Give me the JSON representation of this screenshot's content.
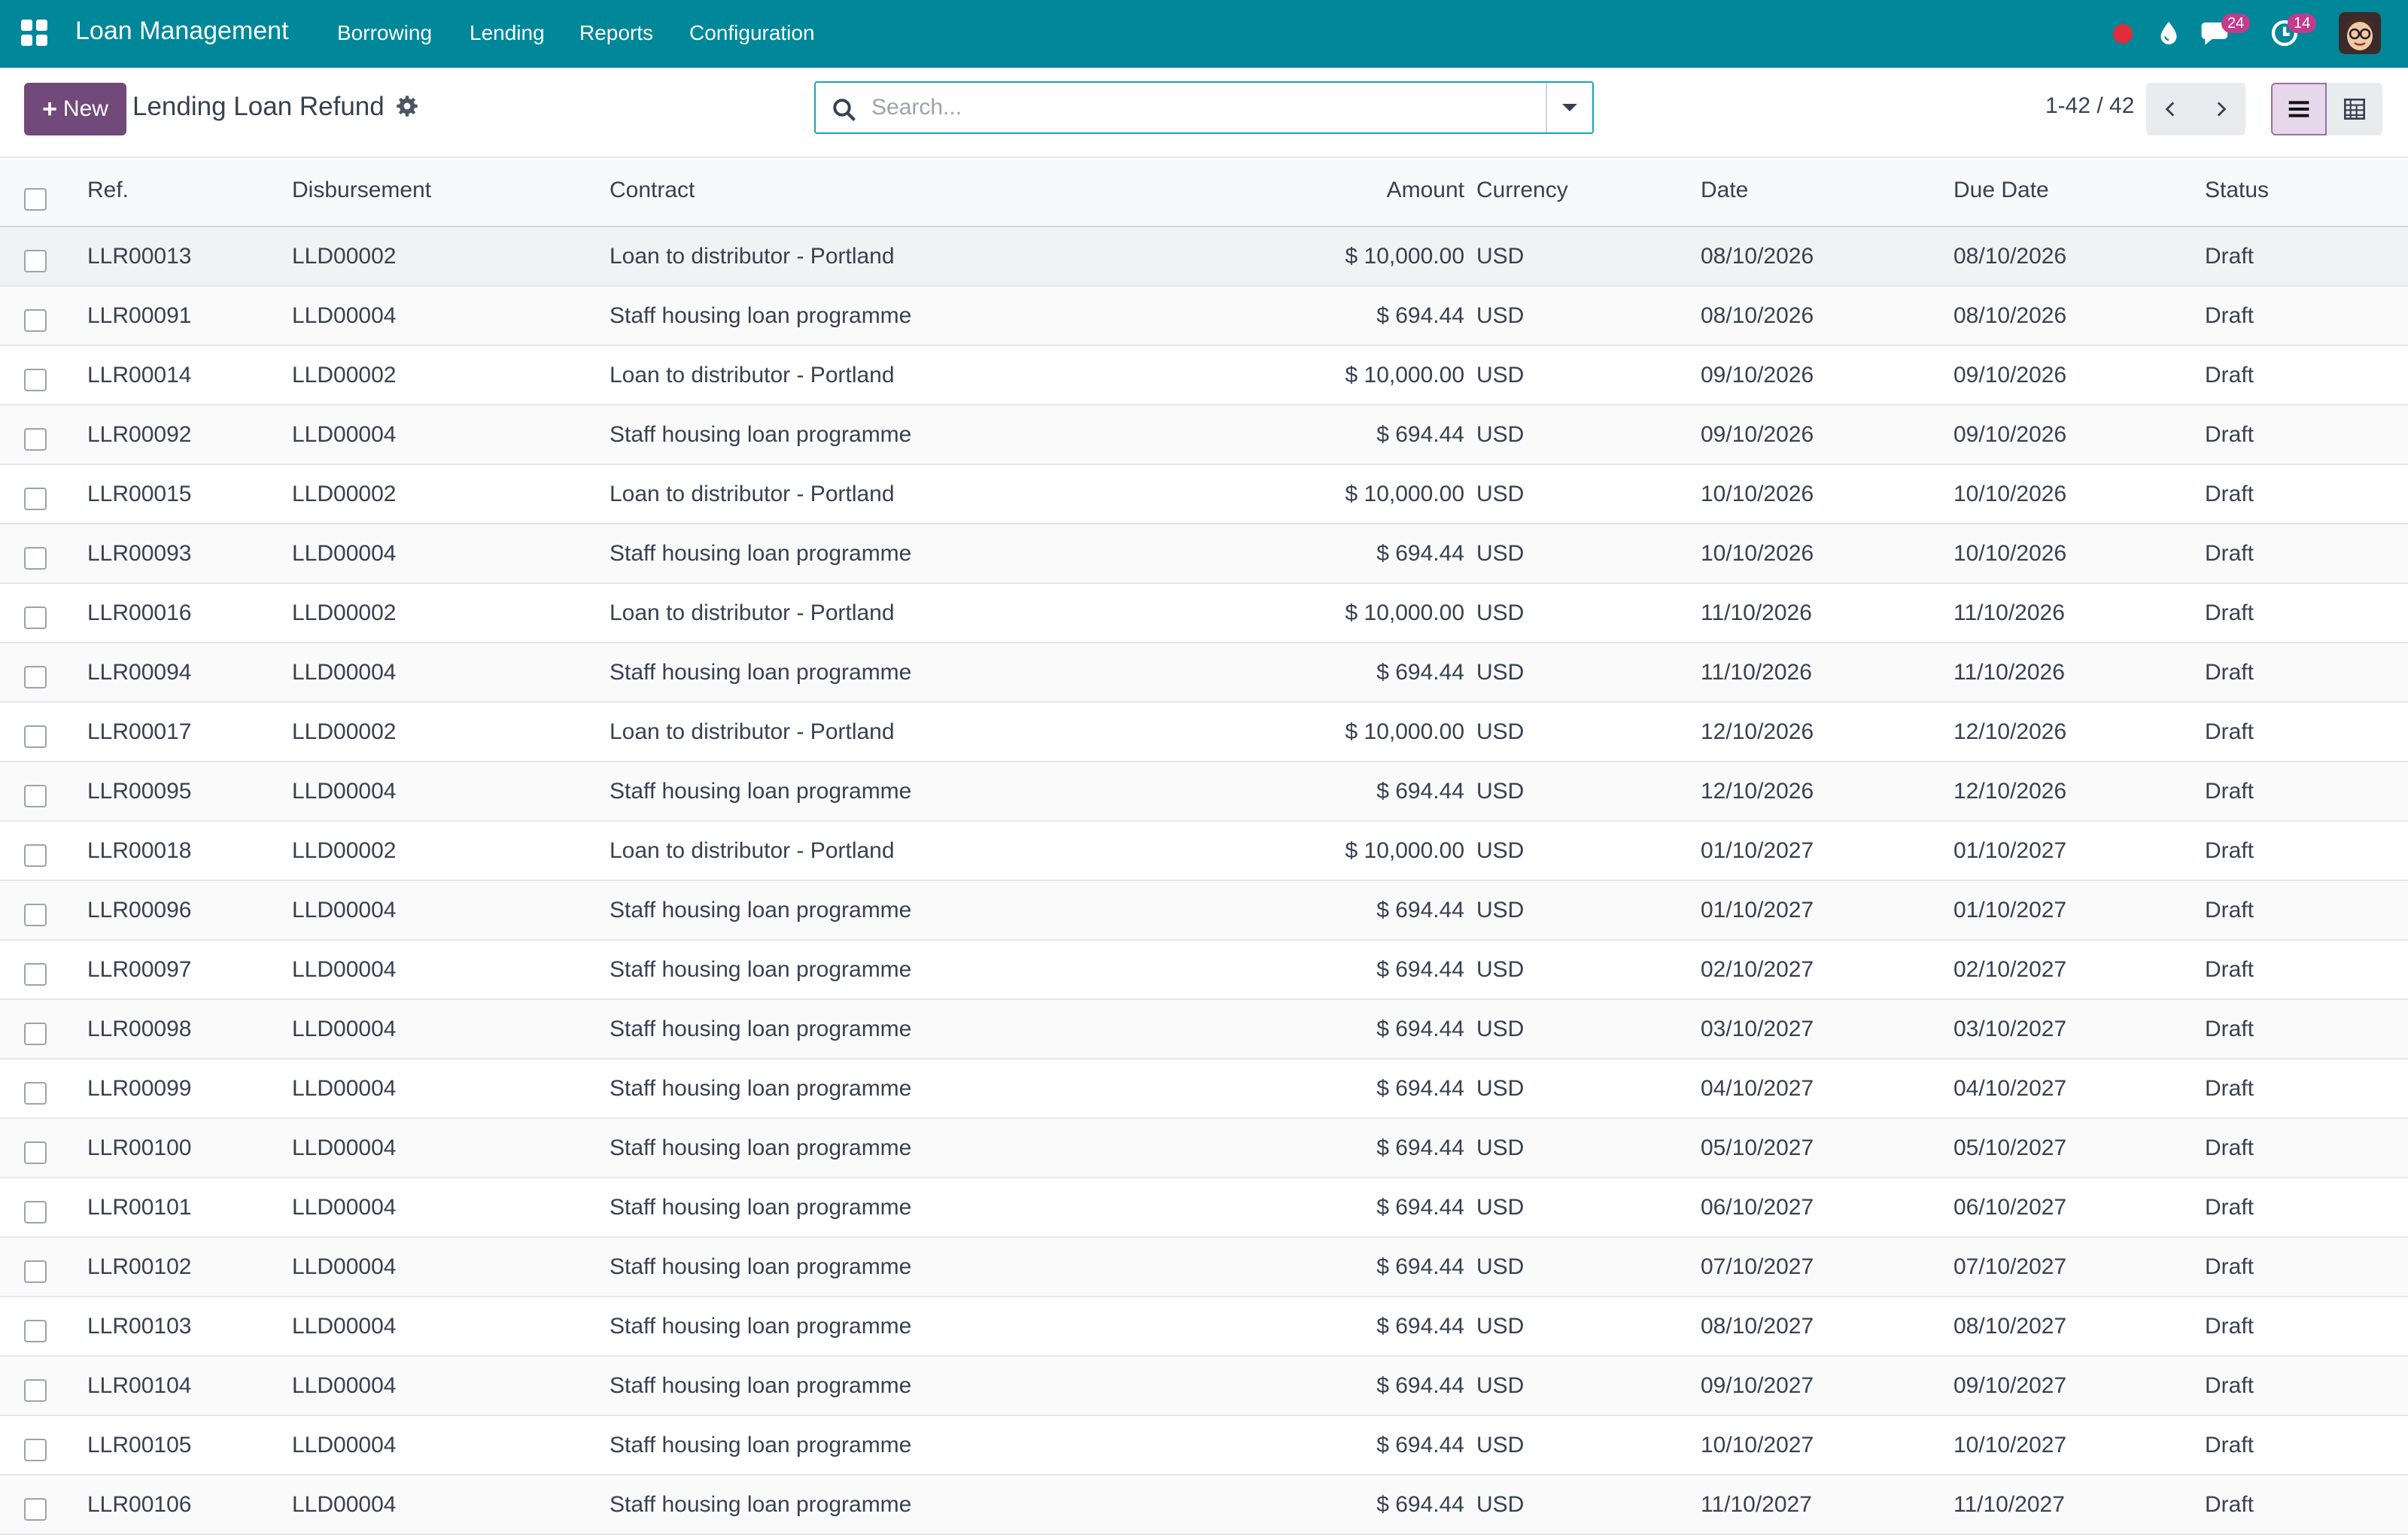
{
  "app": {
    "name": "Loan Management",
    "menus": [
      "Borrowing",
      "Lending",
      "Reports",
      "Configuration"
    ],
    "messages_badge": "24",
    "activities_badge": "14"
  },
  "control": {
    "new_label": "New",
    "title": "Lending Loan Refund",
    "search_placeholder": "Search...",
    "pager": "1-42 / 42"
  },
  "table": {
    "columns": {
      "ref": "Ref.",
      "disbursement": "Disbursement",
      "contract": "Contract",
      "amount": "Amount",
      "currency": "Currency",
      "date": "Date",
      "due_date": "Due Date",
      "status": "Status"
    },
    "rows": [
      {
        "ref": "LLR00013",
        "disbursement": "LLD00002",
        "contract": "Loan to distributor - Portland",
        "amount": "$ 10,000.00",
        "currency": "USD",
        "date": "08/10/2026",
        "due_date": "08/10/2026",
        "status": "Draft"
      },
      {
        "ref": "LLR00091",
        "disbursement": "LLD00004",
        "contract": "Staff housing loan programme",
        "amount": "$ 694.44",
        "currency": "USD",
        "date": "08/10/2026",
        "due_date": "08/10/2026",
        "status": "Draft"
      },
      {
        "ref": "LLR00014",
        "disbursement": "LLD00002",
        "contract": "Loan to distributor - Portland",
        "amount": "$ 10,000.00",
        "currency": "USD",
        "date": "09/10/2026",
        "due_date": "09/10/2026",
        "status": "Draft"
      },
      {
        "ref": "LLR00092",
        "disbursement": "LLD00004",
        "contract": "Staff housing loan programme",
        "amount": "$ 694.44",
        "currency": "USD",
        "date": "09/10/2026",
        "due_date": "09/10/2026",
        "status": "Draft"
      },
      {
        "ref": "LLR00015",
        "disbursement": "LLD00002",
        "contract": "Loan to distributor - Portland",
        "amount": "$ 10,000.00",
        "currency": "USD",
        "date": "10/10/2026",
        "due_date": "10/10/2026",
        "status": "Draft"
      },
      {
        "ref": "LLR00093",
        "disbursement": "LLD00004",
        "contract": "Staff housing loan programme",
        "amount": "$ 694.44",
        "currency": "USD",
        "date": "10/10/2026",
        "due_date": "10/10/2026",
        "status": "Draft"
      },
      {
        "ref": "LLR00016",
        "disbursement": "LLD00002",
        "contract": "Loan to distributor - Portland",
        "amount": "$ 10,000.00",
        "currency": "USD",
        "date": "11/10/2026",
        "due_date": "11/10/2026",
        "status": "Draft"
      },
      {
        "ref": "LLR00094",
        "disbursement": "LLD00004",
        "contract": "Staff housing loan programme",
        "amount": "$ 694.44",
        "currency": "USD",
        "date": "11/10/2026",
        "due_date": "11/10/2026",
        "status": "Draft"
      },
      {
        "ref": "LLR00017",
        "disbursement": "LLD00002",
        "contract": "Loan to distributor - Portland",
        "amount": "$ 10,000.00",
        "currency": "USD",
        "date": "12/10/2026",
        "due_date": "12/10/2026",
        "status": "Draft"
      },
      {
        "ref": "LLR00095",
        "disbursement": "LLD00004",
        "contract": "Staff housing loan programme",
        "amount": "$ 694.44",
        "currency": "USD",
        "date": "12/10/2026",
        "due_date": "12/10/2026",
        "status": "Draft"
      },
      {
        "ref": "LLR00018",
        "disbursement": "LLD00002",
        "contract": "Loan to distributor - Portland",
        "amount": "$ 10,000.00",
        "currency": "USD",
        "date": "01/10/2027",
        "due_date": "01/10/2027",
        "status": "Draft"
      },
      {
        "ref": "LLR00096",
        "disbursement": "LLD00004",
        "contract": "Staff housing loan programme",
        "amount": "$ 694.44",
        "currency": "USD",
        "date": "01/10/2027",
        "due_date": "01/10/2027",
        "status": "Draft"
      },
      {
        "ref": "LLR00097",
        "disbursement": "LLD00004",
        "contract": "Staff housing loan programme",
        "amount": "$ 694.44",
        "currency": "USD",
        "date": "02/10/2027",
        "due_date": "02/10/2027",
        "status": "Draft"
      },
      {
        "ref": "LLR00098",
        "disbursement": "LLD00004",
        "contract": "Staff housing loan programme",
        "amount": "$ 694.44",
        "currency": "USD",
        "date": "03/10/2027",
        "due_date": "03/10/2027",
        "status": "Draft"
      },
      {
        "ref": "LLR00099",
        "disbursement": "LLD00004",
        "contract": "Staff housing loan programme",
        "amount": "$ 694.44",
        "currency": "USD",
        "date": "04/10/2027",
        "due_date": "04/10/2027",
        "status": "Draft"
      },
      {
        "ref": "LLR00100",
        "disbursement": "LLD00004",
        "contract": "Staff housing loan programme",
        "amount": "$ 694.44",
        "currency": "USD",
        "date": "05/10/2027",
        "due_date": "05/10/2027",
        "status": "Draft"
      },
      {
        "ref": "LLR00101",
        "disbursement": "LLD00004",
        "contract": "Staff housing loan programme",
        "amount": "$ 694.44",
        "currency": "USD",
        "date": "06/10/2027",
        "due_date": "06/10/2027",
        "status": "Draft"
      },
      {
        "ref": "LLR00102",
        "disbursement": "LLD00004",
        "contract": "Staff housing loan programme",
        "amount": "$ 694.44",
        "currency": "USD",
        "date": "07/10/2027",
        "due_date": "07/10/2027",
        "status": "Draft"
      },
      {
        "ref": "LLR00103",
        "disbursement": "LLD00004",
        "contract": "Staff housing loan programme",
        "amount": "$ 694.44",
        "currency": "USD",
        "date": "08/10/2027",
        "due_date": "08/10/2027",
        "status": "Draft"
      },
      {
        "ref": "LLR00104",
        "disbursement": "LLD00004",
        "contract": "Staff housing loan programme",
        "amount": "$ 694.44",
        "currency": "USD",
        "date": "09/10/2027",
        "due_date": "09/10/2027",
        "status": "Draft"
      },
      {
        "ref": "LLR00105",
        "disbursement": "LLD00004",
        "contract": "Staff housing loan programme",
        "amount": "$ 694.44",
        "currency": "USD",
        "date": "10/10/2027",
        "due_date": "10/10/2027",
        "status": "Draft"
      },
      {
        "ref": "LLR00106",
        "disbursement": "LLD00004",
        "contract": "Staff housing loan programme",
        "amount": "$ 694.44",
        "currency": "USD",
        "date": "11/10/2027",
        "due_date": "11/10/2027",
        "status": "Draft"
      }
    ]
  },
  "colors": {
    "navbar": "#00879a",
    "primary_button": "#71497a",
    "badge": "#c23b8c",
    "record_dot": "#e02d3c"
  }
}
